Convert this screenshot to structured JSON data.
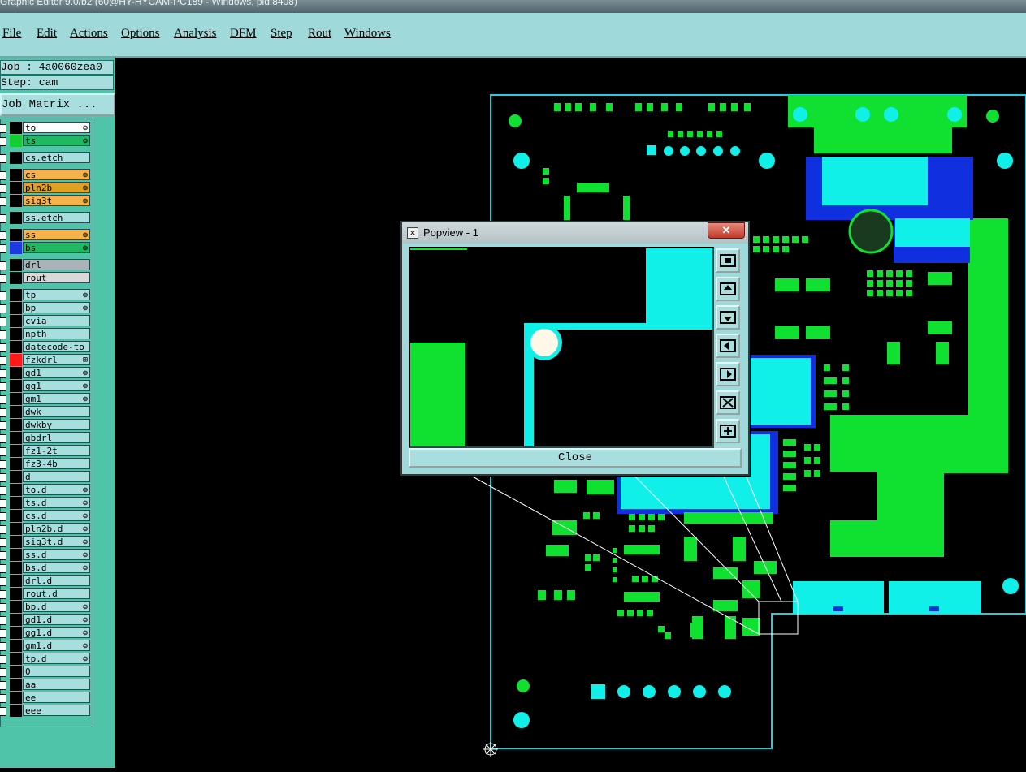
{
  "window_title": "Graphic Editor 9.0/b2 (60@HY-HYCAM-PC189 - Windows, pid:8408)",
  "menu": [
    "File",
    "Edit",
    "Actions",
    "Options",
    "Analysis",
    "DFM",
    "Step",
    "Rout",
    "Windows"
  ],
  "job_info": {
    "job": "Job : 4a0060zea0",
    "step": "Step: cam",
    "matrix_button": "Job Matrix ..."
  },
  "layers": [
    {
      "name": "to",
      "color": "#000000",
      "fill": "#ffffff",
      "mark": "❂",
      "group": 0
    },
    {
      "name": "ts",
      "color": "#15cc33",
      "fill": "#1fb863",
      "mark": "❂",
      "group": 0
    },
    {
      "name": "cs.etch",
      "color": "#000000",
      "fill": "#a8dede",
      "mark": "",
      "group": 1
    },
    {
      "name": "cs",
      "color": "#000000",
      "fill": "#f5b24a",
      "mark": "❂",
      "group": 2
    },
    {
      "name": "pln2b",
      "color": "#000000",
      "fill": "#e0a020",
      "mark": "❂",
      "group": 2
    },
    {
      "name": "sig3t",
      "color": "#000000",
      "fill": "#f5b24a",
      "mark": "❂",
      "group": 2
    },
    {
      "name": "ss.etch",
      "color": "#000000",
      "fill": "#a8dede",
      "mark": "",
      "group": 3
    },
    {
      "name": "ss",
      "color": "#000000",
      "fill": "#f5b24a",
      "mark": "❂",
      "group": 4
    },
    {
      "name": "bs",
      "color": "#1c3ae0",
      "fill": "#1fb863",
      "mark": "❂",
      "group": 4
    },
    {
      "name": "drl",
      "color": "#000000",
      "fill": "#a9b3b8",
      "mark": "",
      "group": 5
    },
    {
      "name": "rout",
      "color": "#000000",
      "fill": "#d9d9d9",
      "mark": "",
      "group": 5
    },
    {
      "name": "tp",
      "color": "#000000",
      "fill": "#a8dede",
      "mark": "❂",
      "group": 6
    },
    {
      "name": "bp",
      "color": "#000000",
      "fill": "#a8dede",
      "mark": "❂",
      "group": 6
    },
    {
      "name": "cvia",
      "color": "#000000",
      "fill": "#a8dede",
      "mark": "",
      "group": 6
    },
    {
      "name": "npth",
      "color": "#000000",
      "fill": "#a8dede",
      "mark": "",
      "group": 6
    },
    {
      "name": "datecode-to",
      "color": "#000000",
      "fill": "#a8dede",
      "mark": "",
      "group": 6
    },
    {
      "name": "fzkdrl",
      "color": "#ff1a1a",
      "fill": "#a8dede",
      "mark": "⊞",
      "group": 6
    },
    {
      "name": "gd1",
      "color": "#000000",
      "fill": "#a8dede",
      "mark": "❂",
      "group": 6
    },
    {
      "name": "gg1",
      "color": "#000000",
      "fill": "#a8dede",
      "mark": "❂",
      "group": 6
    },
    {
      "name": "gm1",
      "color": "#000000",
      "fill": "#a8dede",
      "mark": "❂",
      "group": 6
    },
    {
      "name": "dwk",
      "color": "#000000",
      "fill": "#a8dede",
      "mark": "",
      "group": 6
    },
    {
      "name": "dwkby",
      "color": "#000000",
      "fill": "#a8dede",
      "mark": "",
      "group": 6
    },
    {
      "name": "gbdrl",
      "color": "#000000",
      "fill": "#a8dede",
      "mark": "",
      "group": 6
    },
    {
      "name": "fz1-2t",
      "color": "#000000",
      "fill": "#a8dede",
      "mark": "",
      "group": 6
    },
    {
      "name": "fz3-4b",
      "color": "#000000",
      "fill": "#a8dede",
      "mark": "",
      "group": 6
    },
    {
      "name": "d",
      "color": "#000000",
      "fill": "#a8dede",
      "mark": "",
      "group": 6
    },
    {
      "name": "to.d",
      "color": "#000000",
      "fill": "#a8dede",
      "mark": "❂",
      "group": 6
    },
    {
      "name": "ts.d",
      "color": "#000000",
      "fill": "#a8dede",
      "mark": "❂",
      "group": 6
    },
    {
      "name": "cs.d",
      "color": "#000000",
      "fill": "#a8dede",
      "mark": "❂",
      "group": 6
    },
    {
      "name": "pln2b.d",
      "color": "#000000",
      "fill": "#a8dede",
      "mark": "❂",
      "group": 6
    },
    {
      "name": "sig3t.d",
      "color": "#000000",
      "fill": "#a8dede",
      "mark": "❂",
      "group": 6
    },
    {
      "name": "ss.d",
      "color": "#000000",
      "fill": "#a8dede",
      "mark": "❂",
      "group": 6
    },
    {
      "name": "bs.d",
      "color": "#000000",
      "fill": "#a8dede",
      "mark": "❂",
      "group": 6
    },
    {
      "name": "drl.d",
      "color": "#000000",
      "fill": "#a8dede",
      "mark": "",
      "group": 6
    },
    {
      "name": "rout.d",
      "color": "#000000",
      "fill": "#a8dede",
      "mark": "",
      "group": 6
    },
    {
      "name": "bp.d",
      "color": "#000000",
      "fill": "#a8dede",
      "mark": "❂",
      "group": 6
    },
    {
      "name": "gd1.d",
      "color": "#000000",
      "fill": "#a8dede",
      "mark": "❂",
      "group": 6
    },
    {
      "name": "gg1.d",
      "color": "#000000",
      "fill": "#a8dede",
      "mark": "❂",
      "group": 6
    },
    {
      "name": "gm1.d",
      "color": "#000000",
      "fill": "#a8dede",
      "mark": "❂",
      "group": 6
    },
    {
      "name": "tp.d",
      "color": "#000000",
      "fill": "#a8dede",
      "mark": "❂",
      "group": 6
    },
    {
      "name": "0",
      "color": "#000000",
      "fill": "#a8dede",
      "mark": "",
      "group": 6
    },
    {
      "name": "aa",
      "color": "#000000",
      "fill": "#a8dede",
      "mark": "",
      "group": 6
    },
    {
      "name": "ee",
      "color": "#000000",
      "fill": "#a8dede",
      "mark": "",
      "group": 6
    },
    {
      "name": "eee",
      "color": "#000000",
      "fill": "#a8dede",
      "mark": "",
      "group": 6
    }
  ],
  "popview": {
    "title": "Popview - 1",
    "close_label": "Close"
  },
  "colors": {
    "menu_bg": "#9fd9d9",
    "panel_bg": "#4fc4a8",
    "pcb_green": "#10e030",
    "pcb_cyan": "#10f0e8",
    "pcb_blue": "#1030e0",
    "outline": "#20d0d8"
  }
}
